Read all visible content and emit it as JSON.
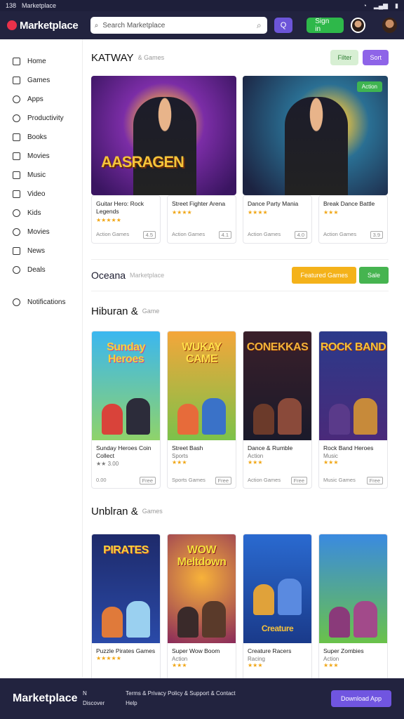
{
  "statusbar": {
    "time": "138",
    "app": "Marketplace",
    "wifi": "wifi-icon",
    "signal": "signal-icon",
    "battery": "battery-icon"
  },
  "header": {
    "logo": "Marketplace",
    "search_placeholder": "Search Marketplace",
    "search_btn": "Q",
    "green_btn": "Sign in"
  },
  "sidebar": {
    "items": [
      {
        "label": "Home",
        "icon": "home-icon"
      },
      {
        "label": "Games",
        "icon": "gamepad-icon"
      },
      {
        "label": "Apps",
        "icon": "apps-icon"
      },
      {
        "label": "Productivity",
        "icon": "briefcase-icon"
      },
      {
        "label": "Books",
        "icon": "book-icon"
      },
      {
        "label": "Movies",
        "icon": "film-icon"
      },
      {
        "label": "Music",
        "icon": "music-icon"
      },
      {
        "label": "Video",
        "icon": "video-icon"
      },
      {
        "label": "Kids",
        "icon": "kids-icon"
      },
      {
        "label": "Movies",
        "icon": "ticket-icon"
      },
      {
        "label": "News",
        "icon": "news-icon"
      },
      {
        "label": "Deals",
        "icon": "tag-icon"
      },
      {
        "label": "Notifications",
        "icon": "bell-icon"
      }
    ]
  },
  "featured": {
    "title": "KATWAY",
    "subtitle": "& Games",
    "btn1": "Filter",
    "btn2": "Sort",
    "cards": [
      {
        "text": "AASRAGEN",
        "badge": ""
      },
      {
        "text": "",
        "badge": "Action"
      }
    ],
    "mini": [
      {
        "title": "Guitar Hero: Rock Legends",
        "stars": "★★★★★",
        "meta": "Action Games",
        "tag": "4.5"
      },
      {
        "title": "Street Fighter Arena",
        "stars": "★★★★",
        "meta": "Action Games",
        "tag": "4.1"
      },
      {
        "title": "Dance Party Mania",
        "stars": "★★★★",
        "meta": "Action Games",
        "tag": "4.0"
      },
      {
        "title": "Break Dance Battle",
        "stars": "★★★",
        "meta": "Action Games",
        "tag": "3.9"
      }
    ]
  },
  "ocean": {
    "title": "Oceana",
    "subtitle": "Marketplace",
    "btn1": "Featured Games",
    "btn2": "Sale"
  },
  "hiburan": {
    "title": "Hiburan &",
    "subtitle": "Game",
    "cards": [
      {
        "art": "Sunday Heroes",
        "title": "Sunday Heroes Coin Collect",
        "sub": "★★ 3.00",
        "stars": "",
        "meta": "0.00",
        "tag": "Free"
      },
      {
        "art": "WUKAY CAME",
        "title": "Street Bash",
        "sub": "Sports",
        "stars": "★★★",
        "meta": "Sports Games",
        "tag": "Free"
      },
      {
        "art": "CONEKKAS",
        "title": "Dance & Rumble",
        "sub": "Action",
        "stars": "★★★",
        "meta": "Action Games",
        "tag": "Free"
      },
      {
        "art": "ROCK BAND",
        "title": "Rock Band Heroes",
        "sub": "Music",
        "stars": "★★★",
        "meta": "Music Games",
        "tag": "Free"
      }
    ]
  },
  "unblran": {
    "title": "Unblran &",
    "subtitle": "Games",
    "cards": [
      {
        "art": "PIRATES",
        "title": "Puzzle Pirates Games",
        "sub": "",
        "stars": "★★★★★"
      },
      {
        "art": "WOW Meltdown",
        "title": "Super Wow Boom",
        "sub": "Action",
        "stars": "★★★"
      },
      {
        "art": "Creature",
        "title": "Creature Racers",
        "sub": "Racing",
        "stars": "★★★"
      },
      {
        "art": "",
        "title": "Super Zombies",
        "sub": "Action",
        "stars": "★★★"
      }
    ]
  },
  "footer": {
    "logo": "Marketplace",
    "col1a": "N",
    "col1b": "Discover",
    "col2a": "Terms & Privacy Policy & Support & Contact",
    "col2b": "Help",
    "btn": "Download App"
  },
  "colors": {
    "nav": "#22233f",
    "accent": "#7055e0",
    "green": "#2eb84a",
    "orange": "#f4b21a"
  }
}
